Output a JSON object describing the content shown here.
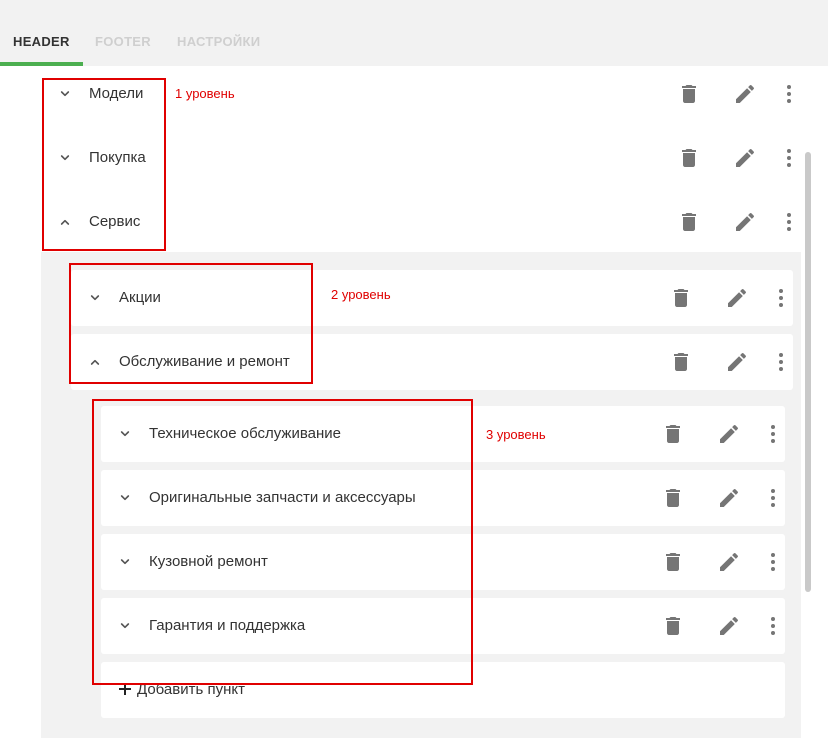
{
  "tabs": [
    {
      "label": "HEADER",
      "active": true
    },
    {
      "label": "FOOTER",
      "active": false
    },
    {
      "label": "НАСТРОЙКИ",
      "active": false
    }
  ],
  "menu": {
    "level1": [
      {
        "label": "Модели",
        "expanded": false
      },
      {
        "label": "Покупка",
        "expanded": false
      },
      {
        "label": "Сервис",
        "expanded": true
      }
    ],
    "level2": [
      {
        "label": "Акции",
        "expanded": false
      },
      {
        "label": "Обслуживание и ремонт",
        "expanded": true
      }
    ],
    "level3": [
      {
        "label": "Техническое обслуживание",
        "expanded": false
      },
      {
        "label": "Оригинальные запчасти и аксессуары",
        "expanded": false
      },
      {
        "label": "Кузовной ремонт",
        "expanded": false
      },
      {
        "label": "Гарантия и поддержка",
        "expanded": false
      }
    ],
    "add_item_label": "Добавить пункт"
  },
  "annotations": {
    "level1": "1 уровень",
    "level2": "2 уровень",
    "level3": "3 уровень"
  },
  "icons": {
    "expand": "chevron-down-icon",
    "collapse": "chevron-up-icon",
    "delete": "trash-icon",
    "edit": "pencil-icon",
    "more": "more-vertical-icon",
    "add": "plus-icon"
  },
  "colors": {
    "active_tab_underline": "#4caf50",
    "annotation_red": "#e00000",
    "icon_gray": "#757575"
  }
}
